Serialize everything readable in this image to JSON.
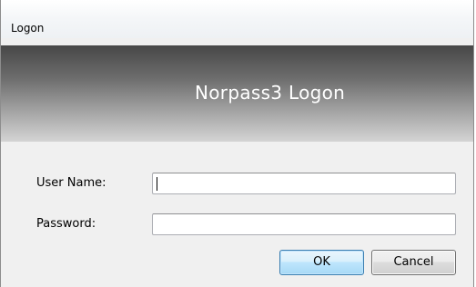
{
  "window": {
    "title": "Logon"
  },
  "banner": {
    "title": "Norpass3 Logon"
  },
  "form": {
    "username_label": "User Name:",
    "username_value": "",
    "password_label": "Password:",
    "password_value": ""
  },
  "buttons": {
    "ok_label": "OK",
    "cancel_label": "Cancel"
  },
  "colors": {
    "banner_dark": "#474747",
    "banner_light": "#d4d4d4",
    "dialog_background": "#f0f0f0",
    "default_button_border": "#3c7fb1"
  }
}
